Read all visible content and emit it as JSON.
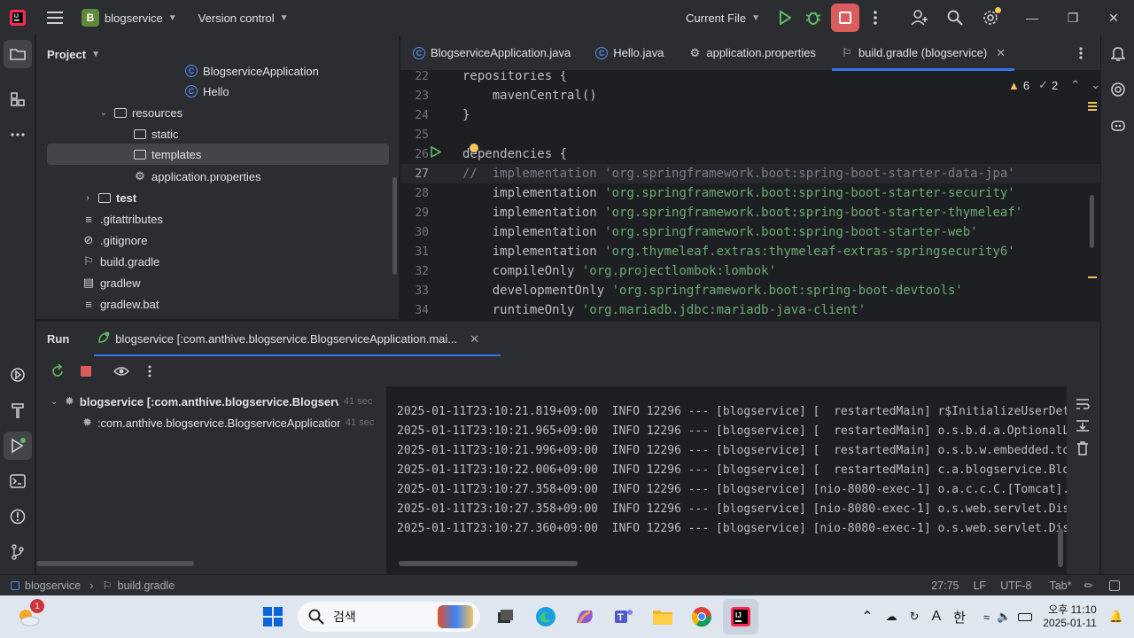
{
  "titlebar": {
    "project_badge": "B",
    "project_name": "blogservice",
    "version_control": "Version control",
    "run_config": "Current File"
  },
  "project_panel": {
    "title": "Project",
    "items": [
      {
        "label": "BlogserviceApplication",
        "kind": "class"
      },
      {
        "label": "Hello",
        "kind": "class"
      },
      {
        "label": "resources",
        "kind": "folder"
      },
      {
        "label": "static",
        "kind": "folder"
      },
      {
        "label": "templates",
        "kind": "folder"
      },
      {
        "label": "application.properties",
        "kind": "settings"
      },
      {
        "label": "test",
        "kind": "folder"
      },
      {
        "label": ".gitattributes",
        "kind": "text"
      },
      {
        "label": ".gitignore",
        "kind": "ignore"
      },
      {
        "label": "build.gradle",
        "kind": "gradle"
      },
      {
        "label": "gradlew",
        "kind": "script"
      },
      {
        "label": "gradlew.bat",
        "kind": "text"
      }
    ]
  },
  "editor": {
    "tabs": [
      {
        "label": "BlogserviceApplication.java"
      },
      {
        "label": "Hello.java"
      },
      {
        "label": "application.properties"
      },
      {
        "label": "build.gradle (blogservice)"
      }
    ],
    "warnings": "6",
    "weak_warnings": "2",
    "lines": [
      {
        "n": "22",
        "pre": "repositories {",
        "str": "",
        "post": ""
      },
      {
        "n": "23",
        "pre": "    mavenCentral()",
        "str": "",
        "post": ""
      },
      {
        "n": "24",
        "pre": "}",
        "str": "",
        "post": ""
      },
      {
        "n": "25",
        "pre": "",
        "str": "",
        "post": ""
      },
      {
        "n": "26",
        "pre": "dependencies {",
        "str": "",
        "post": ""
      },
      {
        "n": "27",
        "pre": "//  implementation ",
        "str": "'org.springframework.boot:spring-boot-starter-data-jpa'",
        "post": ""
      },
      {
        "n": "28",
        "pre": "    implementation ",
        "str": "'org.springframework.boot:spring-boot-starter-security'",
        "post": ""
      },
      {
        "n": "29",
        "pre": "    implementation ",
        "str": "'org.springframework.boot:spring-boot-starter-thymeleaf'",
        "post": ""
      },
      {
        "n": "30",
        "pre": "    implementation ",
        "str": "'org.springframework.boot:spring-boot-starter-web'",
        "post": ""
      },
      {
        "n": "31",
        "pre": "    implementation ",
        "str": "'org.thymeleaf.extras:thymeleaf-extras-springsecurity6'",
        "post": ""
      },
      {
        "n": "32",
        "pre": "    compileOnly ",
        "str": "'org.projectlombok:lombok'",
        "post": ""
      },
      {
        "n": "33",
        "pre": "    developmentOnly ",
        "str": "'org.springframework.boot:spring-boot-devtools'",
        "post": ""
      },
      {
        "n": "34",
        "pre": "    runtimeOnly ",
        "str": "'org.mariadb.jdbc:mariadb-java-client'",
        "post": ""
      }
    ]
  },
  "run_panel": {
    "title": "Run",
    "tab_label": "blogservice [:com.anthive.blogservice.BlogserviceApplication.mai...",
    "tree": [
      {
        "label": "blogservice [:com.anthive.blogservice.BlogserviceA",
        "time": "41 sec"
      },
      {
        "label": ":com.anthive.blogservice.BlogserviceApplication.m",
        "time": "41 sec"
      }
    ],
    "console": [
      "2025-01-11T23:10:21.819+09:00  INFO 12296 --- [blogservice] [  restartedMain] r$InitializeUserDetailsManagerConfigurer",
      "2025-01-11T23:10:21.965+09:00  INFO 12296 --- [blogservice] [  restartedMain] o.s.b.d.a.OptionalLiveReloadServer",
      "2025-01-11T23:10:21.996+09:00  INFO 12296 --- [blogservice] [  restartedMain] o.s.b.w.embedded.tomcat.TomcatWebServer",
      "2025-01-11T23:10:22.006+09:00  INFO 12296 --- [blogservice] [  restartedMain] c.a.blogservice.BlogserviceApplication",
      "2025-01-11T23:10:27.358+09:00  INFO 12296 --- [blogservice] [nio-8080-exec-1] o.a.c.c.C.[Tomcat].[localhost].[/]",
      "2025-01-11T23:10:27.358+09:00  INFO 12296 --- [blogservice] [nio-8080-exec-1] o.s.web.servlet.DispatcherServlet",
      "2025-01-11T23:10:27.360+09:00  INFO 12296 --- [blogservice] [nio-8080-exec-1] o.s.web.servlet.DispatcherServlet"
    ]
  },
  "statusbar": {
    "breadcrumb_project": "blogservice",
    "breadcrumb_file": "build.gradle",
    "position": "27:75",
    "line_sep": "LF",
    "encoding": "UTF-8",
    "indent": "Tab*"
  },
  "taskbar": {
    "weather_badge": "1",
    "search_placeholder": "검색",
    "ime": "한",
    "time_period": "오후 11:10",
    "date": "2025-01-11"
  },
  "colors": {
    "accent": "#3574f0",
    "string": "#6aab73",
    "run_green": "#5fb865",
    "stop_red": "#db5c5c"
  }
}
